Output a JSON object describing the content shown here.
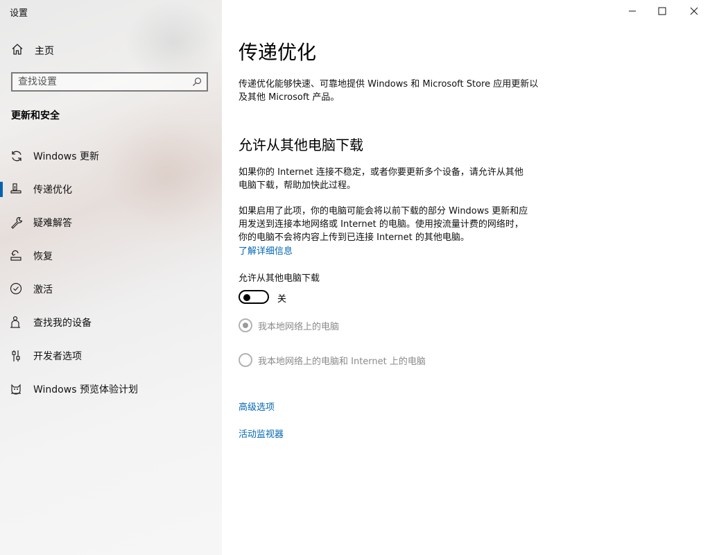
{
  "window": {
    "title": "设置"
  },
  "sidebar": {
    "home_label": "主页",
    "search_placeholder": "查找设置",
    "section_heading": "更新和安全",
    "items": [
      {
        "label": "Windows 更新",
        "icon": "sync-icon",
        "active": false
      },
      {
        "label": "传递优化",
        "icon": "delivery-optimization-icon",
        "active": true
      },
      {
        "label": "疑难解答",
        "icon": "wrench-icon",
        "active": false
      },
      {
        "label": "恢复",
        "icon": "recovery-icon",
        "active": false
      },
      {
        "label": "激活",
        "icon": "check-circle-icon",
        "active": false
      },
      {
        "label": "查找我的设备",
        "icon": "person-location-icon",
        "active": false
      },
      {
        "label": "开发者选项",
        "icon": "developer-sliders-icon",
        "active": false
      },
      {
        "label": "Windows 预览体验计划",
        "icon": "insider-cat-icon",
        "active": false
      }
    ]
  },
  "main": {
    "title": "传递优化",
    "intro_line1": "传递优化能够快速、可靠地提供 Windows 和 Microsoft Store 应用更新以",
    "intro_line2": "及其他 Microsoft 产品。",
    "subheading": "允许从其他电脑下载",
    "para1_line1": "如果你的 Internet 连接不稳定，或者你要更新多个设备，请允许从其他",
    "para1_line2": "电脑下载，帮助加快此过程。",
    "para2_line1": "如果启用了此项，你的电脑可能会将以前下载的部分 Windows 更新和应",
    "para2_line2": "用发送到连接本地网络或 Internet 的电脑。使用按流量计费的网络时，",
    "para2_line3": "你的电脑不会将内容上传到已连接 Internet 的其他电脑。",
    "learn_more": "了解详细信息",
    "toggle_label": "允许从其他电脑下载",
    "toggle_state": "关",
    "radio_local": "我本地网络上的电脑",
    "radio_internet": "我本地网络上的电脑和 Internet 上的电脑",
    "advanced_link": "高级选项",
    "monitor_link": "活动监视器"
  },
  "colors": {
    "accent": "#0063b1",
    "link": "#0066b4",
    "disabled_text": "#8a8a8a"
  }
}
